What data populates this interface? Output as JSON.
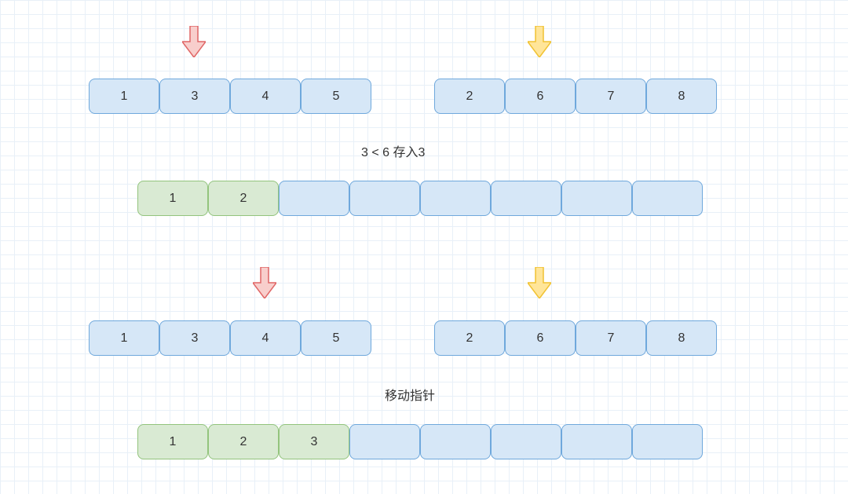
{
  "step1": {
    "arrayLeft": [
      "1",
      "3",
      "4",
      "5"
    ],
    "arrayRight": [
      "2",
      "6",
      "7",
      "8"
    ],
    "pointerLeftIndex": 1,
    "pointerRightIndex": 1,
    "caption": "3 < 6  存入3",
    "merged": {
      "filled": [
        "1",
        "2"
      ],
      "emptyCount": 6
    }
  },
  "step2": {
    "arrayLeft": [
      "1",
      "3",
      "4",
      "5"
    ],
    "arrayRight": [
      "2",
      "6",
      "7",
      "8"
    ],
    "pointerLeftIndex": 2,
    "pointerRightIndex": 1,
    "caption": "移动指针",
    "merged": {
      "filled": [
        "1",
        "2",
        "3"
      ],
      "emptyCount": 5
    }
  },
  "colors": {
    "arrowRed": {
      "fill": "#f8cecc",
      "stroke": "#e06666"
    },
    "arrowYellow": {
      "fill": "#ffe599",
      "stroke": "#f1c232"
    }
  }
}
